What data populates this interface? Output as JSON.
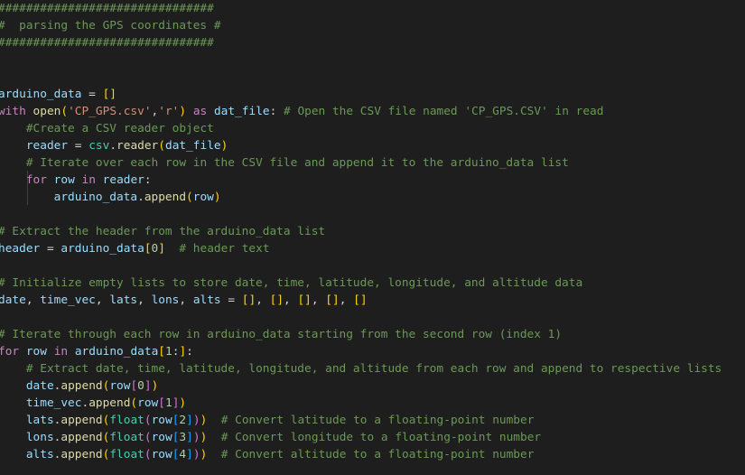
{
  "editor": {
    "lines": [
      [
        {
          "t": "c",
          "x": "###############################"
        }
      ],
      [
        {
          "t": "c",
          "x": "#  parsing the GPS coordinates #"
        }
      ],
      [
        {
          "t": "c",
          "x": "###############################"
        }
      ],
      [],
      [],
      [
        {
          "t": "v",
          "x": "arduino_data"
        },
        {
          "t": "p",
          "x": " = "
        },
        {
          "t": "y",
          "x": "[]"
        }
      ],
      [
        {
          "t": "k",
          "x": "with"
        },
        {
          "t": "p",
          "x": " "
        },
        {
          "t": "f",
          "x": "open"
        },
        {
          "t": "y",
          "x": "("
        },
        {
          "t": "s",
          "x": "'CP_GPS.csv'"
        },
        {
          "t": "p",
          "x": ","
        },
        {
          "t": "s",
          "x": "'r'"
        },
        {
          "t": "y",
          "x": ")"
        },
        {
          "t": "p",
          "x": " "
        },
        {
          "t": "k",
          "x": "as"
        },
        {
          "t": "p",
          "x": " "
        },
        {
          "t": "v",
          "x": "dat_file"
        },
        {
          "t": "p",
          "x": ": "
        },
        {
          "t": "c",
          "x": "# Open the CSV file named 'CP_GPS.CSV' in read"
        }
      ],
      [
        {
          "t": "p",
          "x": "    "
        },
        {
          "t": "c",
          "x": "#Create a CSV reader object"
        }
      ],
      [
        {
          "t": "p",
          "x": "    "
        },
        {
          "t": "v",
          "x": "reader"
        },
        {
          "t": "p",
          "x": " = "
        },
        {
          "t": "b",
          "x": "csv"
        },
        {
          "t": "p",
          "x": "."
        },
        {
          "t": "f",
          "x": "reader"
        },
        {
          "t": "y",
          "x": "("
        },
        {
          "t": "v",
          "x": "dat_file"
        },
        {
          "t": "y",
          "x": ")"
        }
      ],
      [
        {
          "t": "p",
          "x": "    "
        },
        {
          "t": "c",
          "x": "# Iterate over each row in the CSV file and append it to the arduino_data list"
        }
      ],
      [
        {
          "t": "p",
          "x": "    "
        },
        {
          "t": "k",
          "x": "for"
        },
        {
          "t": "p",
          "x": " "
        },
        {
          "t": "v",
          "x": "row"
        },
        {
          "t": "p",
          "x": " "
        },
        {
          "t": "k",
          "x": "in"
        },
        {
          "t": "p",
          "x": " "
        },
        {
          "t": "v",
          "x": "reader"
        },
        {
          "t": "p",
          "x": ":"
        }
      ],
      [
        {
          "t": "p",
          "x": "        "
        },
        {
          "t": "v",
          "x": "arduino_data"
        },
        {
          "t": "p",
          "x": "."
        },
        {
          "t": "f",
          "x": "append"
        },
        {
          "t": "y",
          "x": "("
        },
        {
          "t": "v",
          "x": "row"
        },
        {
          "t": "y",
          "x": ")"
        }
      ],
      [],
      [
        {
          "t": "c",
          "x": "# Extract the header from the arduino_data list"
        }
      ],
      [
        {
          "t": "v",
          "x": "header"
        },
        {
          "t": "p",
          "x": " = "
        },
        {
          "t": "v",
          "x": "arduino_data"
        },
        {
          "t": "y",
          "x": "["
        },
        {
          "t": "n",
          "x": "0"
        },
        {
          "t": "y",
          "x": "]"
        },
        {
          "t": "p",
          "x": "  "
        },
        {
          "t": "c",
          "x": "# header text"
        }
      ],
      [],
      [
        {
          "t": "c",
          "x": "# Initialize empty lists to store date, time, latitude, longitude, and altitude data"
        }
      ],
      [
        {
          "t": "v",
          "x": "date"
        },
        {
          "t": "p",
          "x": ", "
        },
        {
          "t": "v",
          "x": "time_vec"
        },
        {
          "t": "p",
          "x": ", "
        },
        {
          "t": "v",
          "x": "lats"
        },
        {
          "t": "p",
          "x": ", "
        },
        {
          "t": "v",
          "x": "lons"
        },
        {
          "t": "p",
          "x": ", "
        },
        {
          "t": "v",
          "x": "alts"
        },
        {
          "t": "p",
          "x": " = "
        },
        {
          "t": "y",
          "x": "[]"
        },
        {
          "t": "p",
          "x": ", "
        },
        {
          "t": "y",
          "x": "[]"
        },
        {
          "t": "p",
          "x": ", "
        },
        {
          "t": "y",
          "x": "[]"
        },
        {
          "t": "p",
          "x": ", "
        },
        {
          "t": "y",
          "x": "[]"
        },
        {
          "t": "p",
          "x": ", "
        },
        {
          "t": "y",
          "x": "[]"
        }
      ],
      [],
      [
        {
          "t": "c",
          "x": "# Iterate through each row in arduino_data starting from the second row (index 1)"
        }
      ],
      [
        {
          "t": "k",
          "x": "for"
        },
        {
          "t": "p",
          "x": " "
        },
        {
          "t": "v",
          "x": "row"
        },
        {
          "t": "p",
          "x": " "
        },
        {
          "t": "k",
          "x": "in"
        },
        {
          "t": "p",
          "x": " "
        },
        {
          "t": "v",
          "x": "arduino_data"
        },
        {
          "t": "y",
          "x": "["
        },
        {
          "t": "n",
          "x": "1"
        },
        {
          "t": "p",
          "x": ":"
        },
        {
          "t": "y",
          "x": "]"
        },
        {
          "t": "p",
          "x": ":"
        }
      ],
      [
        {
          "t": "p",
          "x": "    "
        },
        {
          "t": "c",
          "x": "# Extract date, time, latitude, longitude, and altitude from each row and append to respective lists"
        }
      ],
      [
        {
          "t": "p",
          "x": "    "
        },
        {
          "t": "v",
          "x": "date"
        },
        {
          "t": "p",
          "x": "."
        },
        {
          "t": "f",
          "x": "append"
        },
        {
          "t": "y",
          "x": "("
        },
        {
          "t": "v",
          "x": "row"
        },
        {
          "t": "m",
          "x": "["
        },
        {
          "t": "n",
          "x": "0"
        },
        {
          "t": "m",
          "x": "]"
        },
        {
          "t": "y",
          "x": ")"
        }
      ],
      [
        {
          "t": "p",
          "x": "    "
        },
        {
          "t": "v",
          "x": "time_vec"
        },
        {
          "t": "p",
          "x": "."
        },
        {
          "t": "f",
          "x": "append"
        },
        {
          "t": "y",
          "x": "("
        },
        {
          "t": "v",
          "x": "row"
        },
        {
          "t": "m",
          "x": "["
        },
        {
          "t": "n",
          "x": "1"
        },
        {
          "t": "m",
          "x": "]"
        },
        {
          "t": "y",
          "x": ")"
        }
      ],
      [
        {
          "t": "p",
          "x": "    "
        },
        {
          "t": "v",
          "x": "lats"
        },
        {
          "t": "p",
          "x": "."
        },
        {
          "t": "f",
          "x": "append"
        },
        {
          "t": "y",
          "x": "("
        },
        {
          "t": "b",
          "x": "float"
        },
        {
          "t": "m",
          "x": "("
        },
        {
          "t": "v",
          "x": "row"
        },
        {
          "t": "q",
          "x": "["
        },
        {
          "t": "n",
          "x": "2"
        },
        {
          "t": "q",
          "x": "]"
        },
        {
          "t": "m",
          "x": ")"
        },
        {
          "t": "y",
          "x": ")"
        },
        {
          "t": "p",
          "x": "  "
        },
        {
          "t": "c",
          "x": "# Convert latitude to a floating-point number"
        }
      ],
      [
        {
          "t": "p",
          "x": "    "
        },
        {
          "t": "v",
          "x": "lons"
        },
        {
          "t": "p",
          "x": "."
        },
        {
          "t": "f",
          "x": "append"
        },
        {
          "t": "y",
          "x": "("
        },
        {
          "t": "b",
          "x": "float"
        },
        {
          "t": "m",
          "x": "("
        },
        {
          "t": "v",
          "x": "row"
        },
        {
          "t": "q",
          "x": "["
        },
        {
          "t": "n",
          "x": "3"
        },
        {
          "t": "q",
          "x": "]"
        },
        {
          "t": "m",
          "x": ")"
        },
        {
          "t": "y",
          "x": ")"
        },
        {
          "t": "p",
          "x": "  "
        },
        {
          "t": "c",
          "x": "# Convert longitude to a floating-point number"
        }
      ],
      [
        {
          "t": "p",
          "x": "    "
        },
        {
          "t": "v",
          "x": "alts"
        },
        {
          "t": "p",
          "x": "."
        },
        {
          "t": "f",
          "x": "append"
        },
        {
          "t": "y",
          "x": "("
        },
        {
          "t": "b",
          "x": "float"
        },
        {
          "t": "m",
          "x": "("
        },
        {
          "t": "v",
          "x": "row"
        },
        {
          "t": "q",
          "x": "["
        },
        {
          "t": "n",
          "x": "4"
        },
        {
          "t": "q",
          "x": "]"
        },
        {
          "t": "m",
          "x": ")"
        },
        {
          "t": "y",
          "x": ")"
        },
        {
          "t": "p",
          "x": "  "
        },
        {
          "t": "c",
          "x": "# Convert altitude to a floating-point number"
        }
      ]
    ]
  }
}
